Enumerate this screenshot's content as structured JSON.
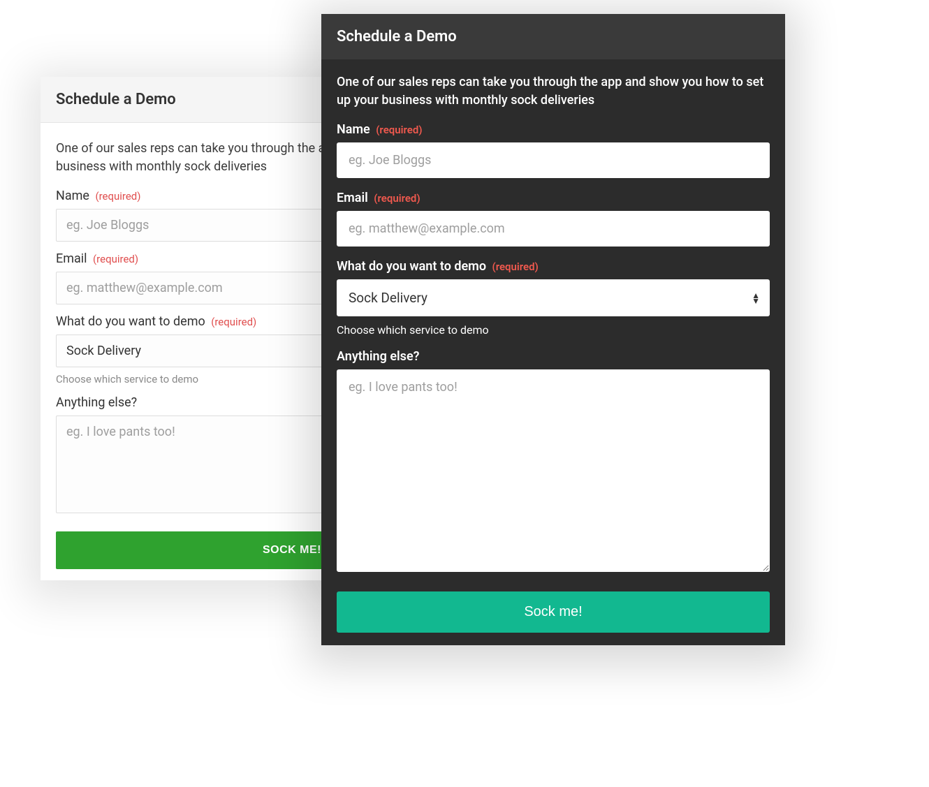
{
  "title": "Schedule a Demo",
  "intro": "One of our sales reps can take you through the app and show you how to set up your business with monthly sock deliveries",
  "required_tag": "(required)",
  "fields": {
    "name": {
      "label": "Name",
      "placeholder": "eg. Joe Bloggs",
      "required": true
    },
    "email": {
      "label": "Email",
      "placeholder": "eg. matthew@example.com",
      "required": true
    },
    "demo": {
      "label": "What do you want to demo",
      "selected": "Sock Delivery",
      "help": "Choose which service to demo",
      "required": true
    },
    "else": {
      "label": "Anything else?",
      "placeholder": "eg. I love pants too!",
      "required": false
    }
  },
  "submit_light": "SOCK ME!",
  "submit_dark": "Sock me!"
}
